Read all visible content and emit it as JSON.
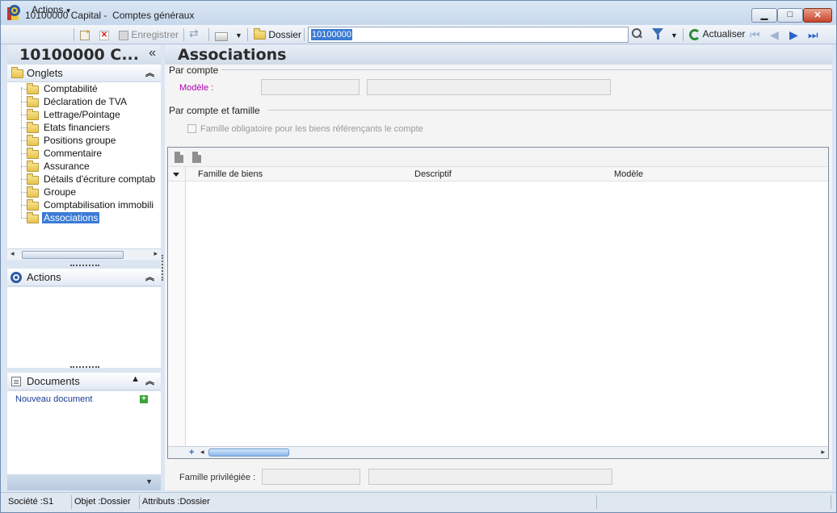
{
  "window": {
    "title": "10100000 Capital -  Comptes généraux",
    "min_glyph": "▁",
    "max_glyph": "□",
    "close_glyph": "✕"
  },
  "toolbar": {
    "actions_label": "Actions",
    "save_label": "Enregistrer",
    "folder_label": "Dossier",
    "search_value": "10100000",
    "refresh_label": "Actualiser"
  },
  "left": {
    "title": "10100000 C...",
    "collapse_glyph": "«",
    "tabs_header": "Onglets",
    "tree": [
      {
        "label": "Comptabilité"
      },
      {
        "label": "Déclaration de TVA"
      },
      {
        "label": "Lettrage/Pointage"
      },
      {
        "label": "Etats financiers"
      },
      {
        "label": "Positions groupe"
      },
      {
        "label": "Commentaire"
      },
      {
        "label": "Assurance"
      },
      {
        "label": "Détails d'écriture comptab"
      },
      {
        "label": "Groupe"
      },
      {
        "label": "Comptabilisation immobili"
      },
      {
        "label": "Associations"
      }
    ],
    "selected_index": 10,
    "actions_header": "Actions",
    "documents_header": "Documents",
    "new_document_link": "Nouveau document"
  },
  "main": {
    "title": "Associations",
    "group_by_account": "Par compte",
    "model_label": "Modèle :",
    "group_by_account_family": "Par compte et famille",
    "mandatory_family_label": "Famille obligatoire pour les biens référençants le compte",
    "mandatory_family_checked": false,
    "grid_columns": [
      "Famille de biens",
      "Descriptif",
      "Modèle"
    ],
    "grid_rows": [],
    "preferred_family_label": "Famille privilégiée :"
  },
  "status": {
    "company": "Société :S1",
    "object": "Objet :Dossier",
    "attributes": "Attributs :Dossier"
  },
  "colors": {
    "selection": "#3a7bd5",
    "required_label": "#b000b0",
    "link": "#1b3c8f"
  }
}
